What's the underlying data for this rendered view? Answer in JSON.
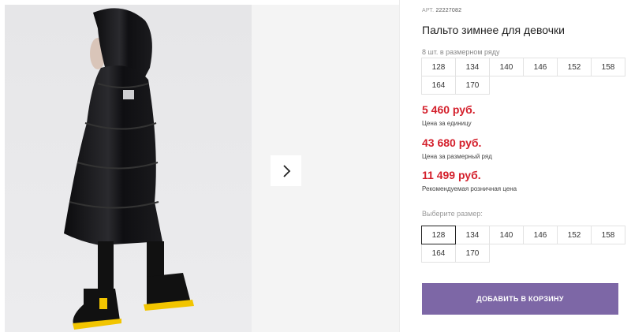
{
  "product": {
    "sku_prefix": "АРТ.",
    "sku": "22227082",
    "title": "Пальто зимнее для девочки",
    "image_alt": "product-photo-girl-in-black-winter-coat"
  },
  "pack": {
    "label": "8 шт. в размерном ряду",
    "sizes": [
      "128",
      "134",
      "140",
      "146",
      "152",
      "158",
      "164",
      "170"
    ]
  },
  "prices": {
    "unit_price": "5 460 руб.",
    "unit_label": "Цена за единицу",
    "pack_price": "43 680 руб.",
    "pack_label": "Цена за размерный ряд",
    "retail_price": "11 499 руб.",
    "retail_label": "Рекомендуемая розничная цена"
  },
  "size_select": {
    "label": "Выберите размер:",
    "sizes": [
      "128",
      "134",
      "140",
      "146",
      "152",
      "158",
      "164",
      "170"
    ],
    "selected": "128"
  },
  "cart": {
    "button_label": "ДОБАВИТЬ В КОРЗИНУ"
  },
  "icons": {
    "next": "chevron-right-icon"
  },
  "colors": {
    "price": "#d4202c",
    "cart_button": "#7d67a6"
  }
}
